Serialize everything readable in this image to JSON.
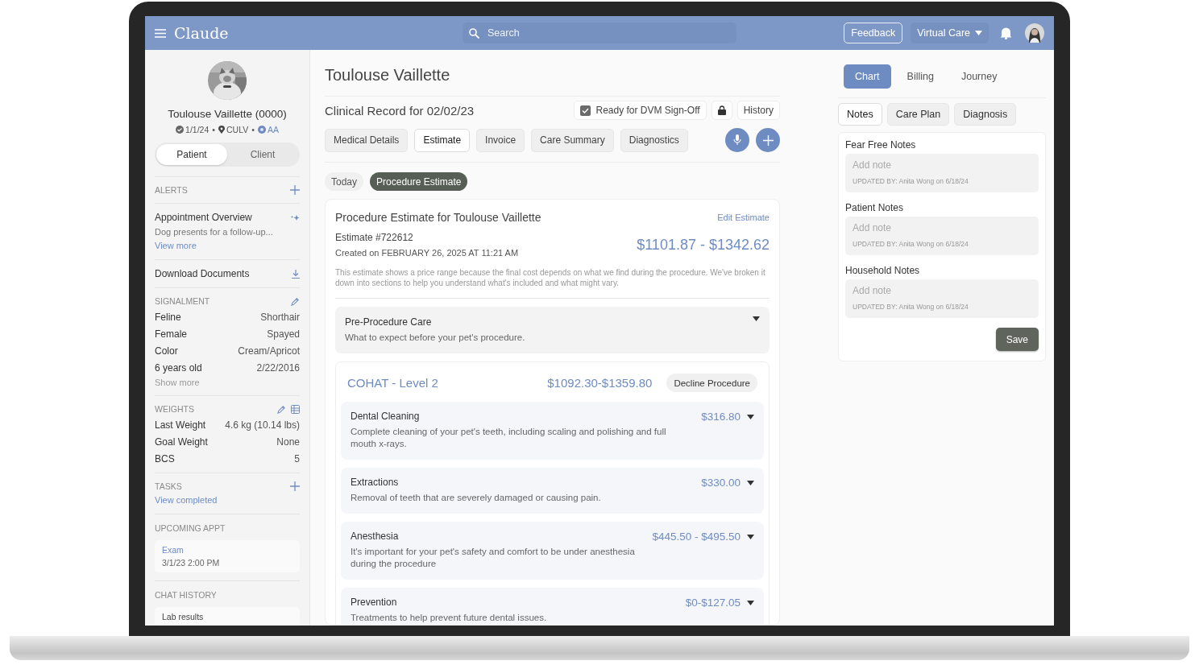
{
  "header": {
    "logo": "Claude",
    "search": {
      "placeholder": "Search"
    },
    "feedback": "Feedback",
    "virtual_care": "Virtual Care"
  },
  "sidebar": {
    "patient_name": "Toulouse Vaillette (0000)",
    "meta": [
      {
        "kind": "date",
        "text": "1/1/24"
      },
      {
        "kind": "location",
        "text": "CULV"
      },
      {
        "kind": "vet",
        "text": "AA"
      }
    ],
    "separator": "•",
    "toggle": [
      {
        "label": "Patient",
        "selected": true
      },
      {
        "label": "Client",
        "selected": false
      }
    ],
    "alerts": {
      "title": "ALERTS"
    },
    "appointment": {
      "title": "Appointment Overview",
      "summary": "Dog presents for a follow-up...",
      "link": "View more"
    },
    "download": "Download Documents",
    "signalment": {
      "title": "SIGNALMENT",
      "rows": [
        {
          "label": "Feline",
          "value": "Shorthair"
        },
        {
          "label": "Female",
          "value": "Spayed"
        },
        {
          "label": "Color",
          "value": "Cream/Apricot"
        },
        {
          "label": "6 years old",
          "value": "2/22/2016"
        }
      ],
      "link": "Show more"
    },
    "weights": {
      "title": "WEIGHTS",
      "rows": [
        {
          "label": "Last Weight",
          "value": "4.6 kg (10.14 lbs)"
        },
        {
          "label": "Goal Weight",
          "value": "None"
        },
        {
          "label": "BCS",
          "value": "5"
        }
      ]
    },
    "tasks": {
      "title": "TASKS",
      "link": "View completed"
    },
    "upcoming": {
      "title": "UPCOMING APPT",
      "type": "Exam",
      "when": "3/1/23 2:00 PM"
    },
    "chat": {
      "title": "CHAT HISTORY",
      "items": [
        "Lab results"
      ]
    }
  },
  "main": {
    "title": "Toulouse Vaillette",
    "record_title": "Clinical Record for 02/02/23",
    "sign_off": {
      "label": "Ready for DVM Sign-Off",
      "checked": true
    },
    "history": "History",
    "tabs": [
      {
        "label": "Medical Details",
        "selected": false
      },
      {
        "label": "Estimate",
        "selected": true
      },
      {
        "label": "Invoice",
        "selected": false
      },
      {
        "label": "Care Summary",
        "selected": false
      },
      {
        "label": "Diagnostics",
        "selected": false
      }
    ],
    "subtabs": [
      {
        "label": "Today",
        "selected": false
      },
      {
        "label": "Procedure Estimate",
        "selected": true
      }
    ],
    "estimate": {
      "title": "Procedure Estimate for Toulouse Vaillette",
      "edit": "Edit Estimate",
      "number": "Estimate #722612",
      "created": "Created on FEBRUARY 26, 2025 AT 11:21 AM",
      "total": "$1101.87 - $1342.62",
      "note": "This estimate shows a price range because the final cost depends on what we find during the procedure. We've broken it down into sections to help you understand what's included and what might vary.",
      "pre_care": {
        "title": "Pre-Procedure Care",
        "desc": "What to expect before your pet's procedure."
      },
      "procedure": {
        "name": "COHAT - Level 2",
        "price": "$1092.30-$1359.80",
        "decline": "Decline Procedure",
        "items": [
          {
            "title": "Dental Cleaning",
            "price": "$316.80",
            "desc": "Complete cleaning of your pet's teeth, including scaling and polishing and full mouth x-rays."
          },
          {
            "title": "Extractions",
            "price": "$330.00",
            "desc": "Removal of teeth that are severely damaged or causing pain."
          },
          {
            "title": "Anesthesia",
            "price": "$445.50 - $495.50",
            "desc": "It's important for your pet's safety and comfort to be under anesthesia during the procedure"
          },
          {
            "title": "Prevention",
            "price": "$0-$127.05",
            "desc": "Treatments to help prevent future dental issues."
          }
        ]
      }
    }
  },
  "right": {
    "tabs": [
      {
        "label": "Chart",
        "selected": true
      },
      {
        "label": "Billing",
        "selected": false
      },
      {
        "label": "Journey",
        "selected": false
      }
    ],
    "subtabs": [
      {
        "label": "Notes",
        "selected": true
      },
      {
        "label": "Care Plan",
        "selected": false
      },
      {
        "label": "Diagnosis",
        "selected": false
      }
    ],
    "notes": [
      {
        "title": "Fear Free Notes",
        "placeholder": "Add note",
        "updated": "UPDATED BY: Anita Wong on 6/18/24"
      },
      {
        "title": "Patient Notes",
        "placeholder": "Add note",
        "updated": "UPDATED BY: Anita Wong on 6/18/24"
      },
      {
        "title": "Household Notes",
        "placeholder": "Add note",
        "updated": "UPDATED BY: Anita Wong on 6/18/24"
      }
    ],
    "save": "Save"
  }
}
